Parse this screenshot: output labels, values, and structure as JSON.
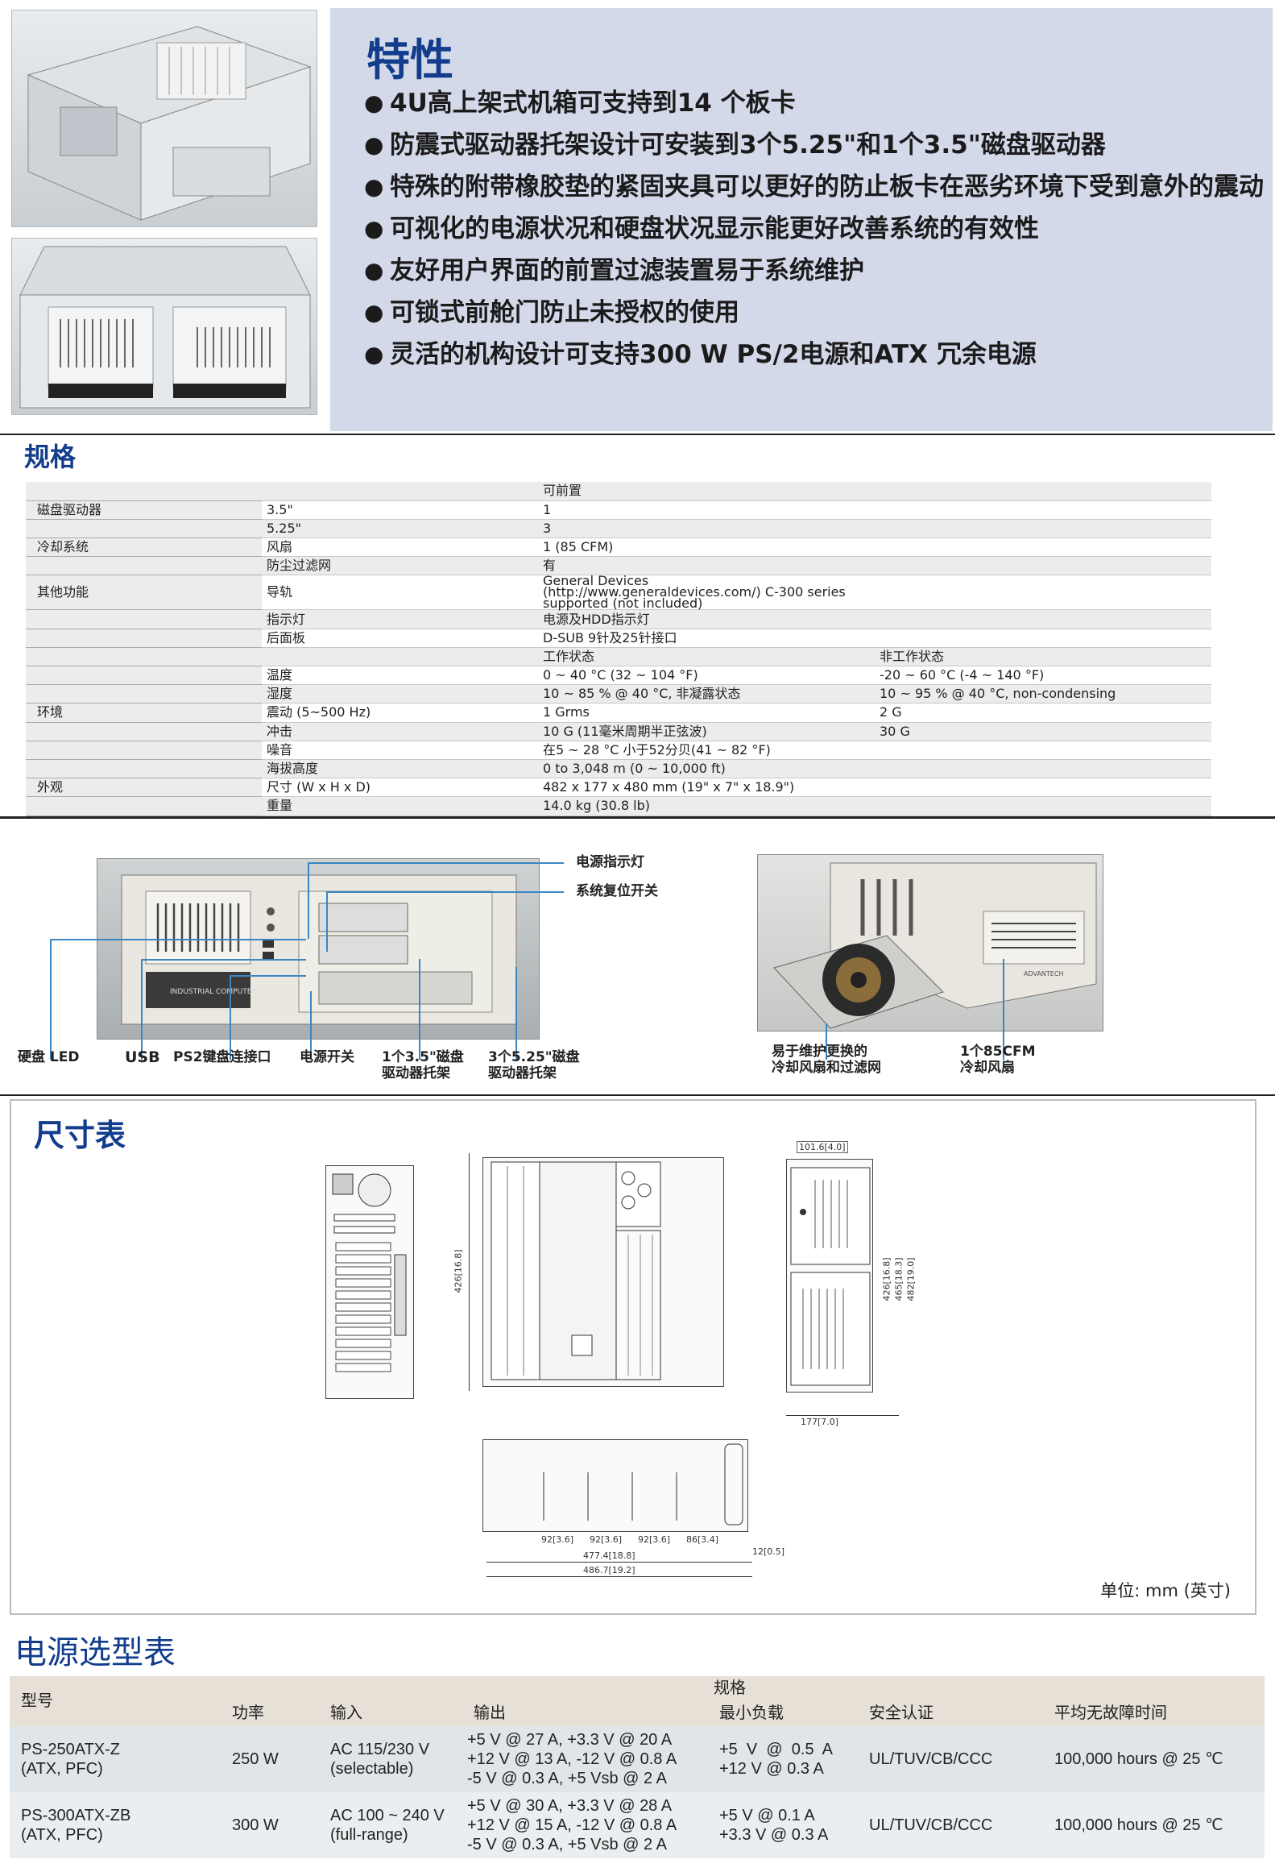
{
  "features": {
    "title": "特性",
    "bullet": "●",
    "items": [
      "4U高上架式机箱可支持到14 个板卡",
      "防震式驱动器托架设计可安装到3个5.25\"和1个3.5\"磁盘驱动器",
      "特殊的附带橡胶垫的紧固夹具可以更好的防止板卡在恶劣环境下受到意外的震动",
      "可视化的电源状况和硬盘状况显示能更好改善系统的有效性",
      "友好用户界面的前置过滤装置易于系统维护",
      "可锁式前舱门防止未授权的使用",
      "灵活的机构设计可支持300 W PS/2电源和ATX 冗余电源"
    ]
  },
  "spec": {
    "title": "规格",
    "rows": [
      {
        "cat": "",
        "sub": "",
        "v1": "可前置",
        "v2": ""
      },
      {
        "cat": "磁盘驱动器",
        "sub": "3.5\"",
        "v1": "1",
        "v2": ""
      },
      {
        "cat": "",
        "sub": "5.25\"",
        "v1": "3",
        "v2": ""
      },
      {
        "cat": "冷却系统",
        "sub": "风扇",
        "v1": "1 (85 CFM)",
        "v2": ""
      },
      {
        "cat": "",
        "sub": "防尘过滤网",
        "v1": "有",
        "v2": ""
      },
      {
        "cat": "其他功能",
        "sub": "导轨",
        "v1": "General Devices (http://www.generaldevices.com/) C-300 series supported (not included)",
        "v2": ""
      },
      {
        "cat": "",
        "sub": "指示灯",
        "v1": "电源及HDD指示灯",
        "v2": ""
      },
      {
        "cat": "",
        "sub": "后面板",
        "v1": "D-SUB 9针及25针接口",
        "v2": ""
      },
      {
        "cat": "",
        "sub": "",
        "v1": "工作状态",
        "v2": "非工作状态"
      },
      {
        "cat": "",
        "sub": "温度",
        "v1": "0 ~ 40 °C (32 ~ 104 °F)",
        "v2": "-20 ~ 60 °C (-4 ~ 140 °F)"
      },
      {
        "cat": "",
        "sub": "湿度",
        "v1": "10 ~ 85 % @ 40 °C, 非凝露状态",
        "v2": "10 ~ 95 % @ 40 °C, non-condensing"
      },
      {
        "cat": "环境",
        "sub": "震动 (5~500 Hz)",
        "v1": "1 Grms",
        "v2": "2 G"
      },
      {
        "cat": "",
        "sub": "冲击",
        "v1": "10 G (11毫米周期半正弦波)",
        "v2": "30 G"
      },
      {
        "cat": "",
        "sub": "噪音",
        "v1": "在5 ~ 28 °C 小于52分贝(41 ~ 82 °F)",
        "v2": ""
      },
      {
        "cat": "",
        "sub": "海拔高度",
        "v1": "0 to 3,048 m (0 ~ 10,000 ft)",
        "v2": ""
      },
      {
        "cat": "外观",
        "sub": "尺寸 (W x H x D)",
        "v1": "482 x 177 x 480 mm (19\" x 7\" x 18.9\")",
        "v2": ""
      },
      {
        "cat": "",
        "sub": "重量",
        "v1": "14.0 kg (30.8 lb)",
        "v2": ""
      }
    ]
  },
  "front": {
    "power_led": "电源指示灯",
    "reset": "系统复位开关",
    "hdd_led": "硬盘 LED",
    "usb": "USB",
    "ps2": "PS2键盘连接口",
    "power_switch": "电源开关",
    "bay35": [
      "1个3.5\"磁盘",
      "驱动器托架"
    ],
    "bay525": [
      "3个5.25\"磁盘",
      "驱动器托架"
    ],
    "filter": [
      "易于维护更换的",
      "冷却风扇和过滤网"
    ],
    "fan": [
      "1个85CFM",
      "冷却风扇"
    ],
    "panel_text": "INDUSTRIAL COMPUTER",
    "brand": "ADVANTECH"
  },
  "dims": {
    "title": "尺寸表",
    "unit": "单位: mm (英寸)",
    "d_426a": "426[16.8]",
    "d_1016": "101.6[4.0]",
    "d_426b": "426[16.8]",
    "d_465": "465[18.3]",
    "d_482": "482[19.0]",
    "d_177": "177[7.0]",
    "d_92a": "92[3.6]",
    "d_92b": "92[3.6]",
    "d_92c": "92[3.6]",
    "d_86": "86[3.4]",
    "d_12": "12[0.5]",
    "d_4774": "477.4[18.8]",
    "d_4867": "486.7[19.2]"
  },
  "psu": {
    "title": "电源选型表",
    "spec_label": "规格",
    "headers": [
      "型号",
      "功率",
      "输入",
      "输出",
      "最小负载",
      "安全认证",
      "平均无故障时间"
    ],
    "rows": [
      {
        "model": [
          "PS-250ATX-Z",
          "(ATX, PFC)"
        ],
        "power": "250 W",
        "input": [
          "AC 115/230 V",
          "(selectable)"
        ],
        "output": [
          "+5 V @ 27 A, +3.3 V @ 20 A",
          "+12 V @ 13 A, -12 V @ 0.8 A",
          "-5 V @ 0.3 A, +5 Vsb @ 2 A"
        ],
        "minload": [
          "+5  V  @  0.5  A",
          "+12 V @ 0.3 A"
        ],
        "safety": "UL/TUV/CB/CCC",
        "mtbf": "100,000 hours @ 25 ℃"
      },
      {
        "model": [
          "PS-300ATX-ZB",
          "(ATX, PFC)"
        ],
        "power": "300 W",
        "input": [
          "AC 100 ~ 240 V",
          "(full-range)"
        ],
        "output": [
          "+5 V @ 30 A, +3.3 V @ 28 A",
          "+12 V @ 15 A, -12 V @ 0.8 A",
          "-5 V @ 0.3 A, +5 Vsb @ 2 A"
        ],
        "minload": [
          "+5 V @ 0.1 A",
          "+3.3 V @ 0.3 A"
        ],
        "safety": "UL/TUV/CB/CCC",
        "mtbf": "100,000 hours @ 25 ℃"
      }
    ]
  }
}
